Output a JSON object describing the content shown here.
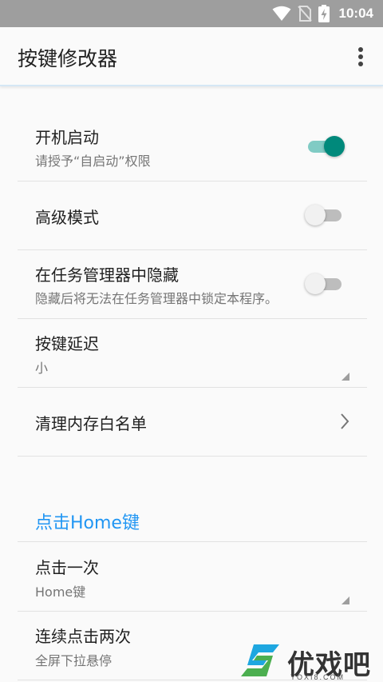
{
  "status_bar": {
    "time": "10:04",
    "icons": [
      "wifi-icon",
      "no-sim-icon",
      "battery-charging-icon"
    ]
  },
  "app_bar": {
    "title": "按键修改器",
    "more_icon": "more-vert-icon"
  },
  "settings": {
    "boot_start": {
      "title": "开机启动",
      "summary": "请授予“自启动”权限",
      "enabled": true
    },
    "advanced_mode": {
      "title": "高级模式",
      "enabled": false
    },
    "hide_in_task_manager": {
      "title": "在任务管理器中隐藏",
      "summary": "隐藏后将无法在任务管理器中锁定本程序。",
      "enabled": false
    },
    "key_delay": {
      "title": "按键延迟",
      "value": "小"
    },
    "memory_whitelist": {
      "title": "清理内存白名单"
    }
  },
  "home_section": {
    "header": "点击Home键",
    "single_click": {
      "title": "点击一次",
      "value": "Home键"
    },
    "double_click": {
      "title": "连续点击两次",
      "value": "全屏下拉悬停"
    }
  },
  "watermark": {
    "text": "优戏吧",
    "sub": "YOXI8.COM"
  },
  "colors": {
    "accent": "#2196f3",
    "toggle_on": "#00897b",
    "status_bar": "#9e9e9e"
  }
}
